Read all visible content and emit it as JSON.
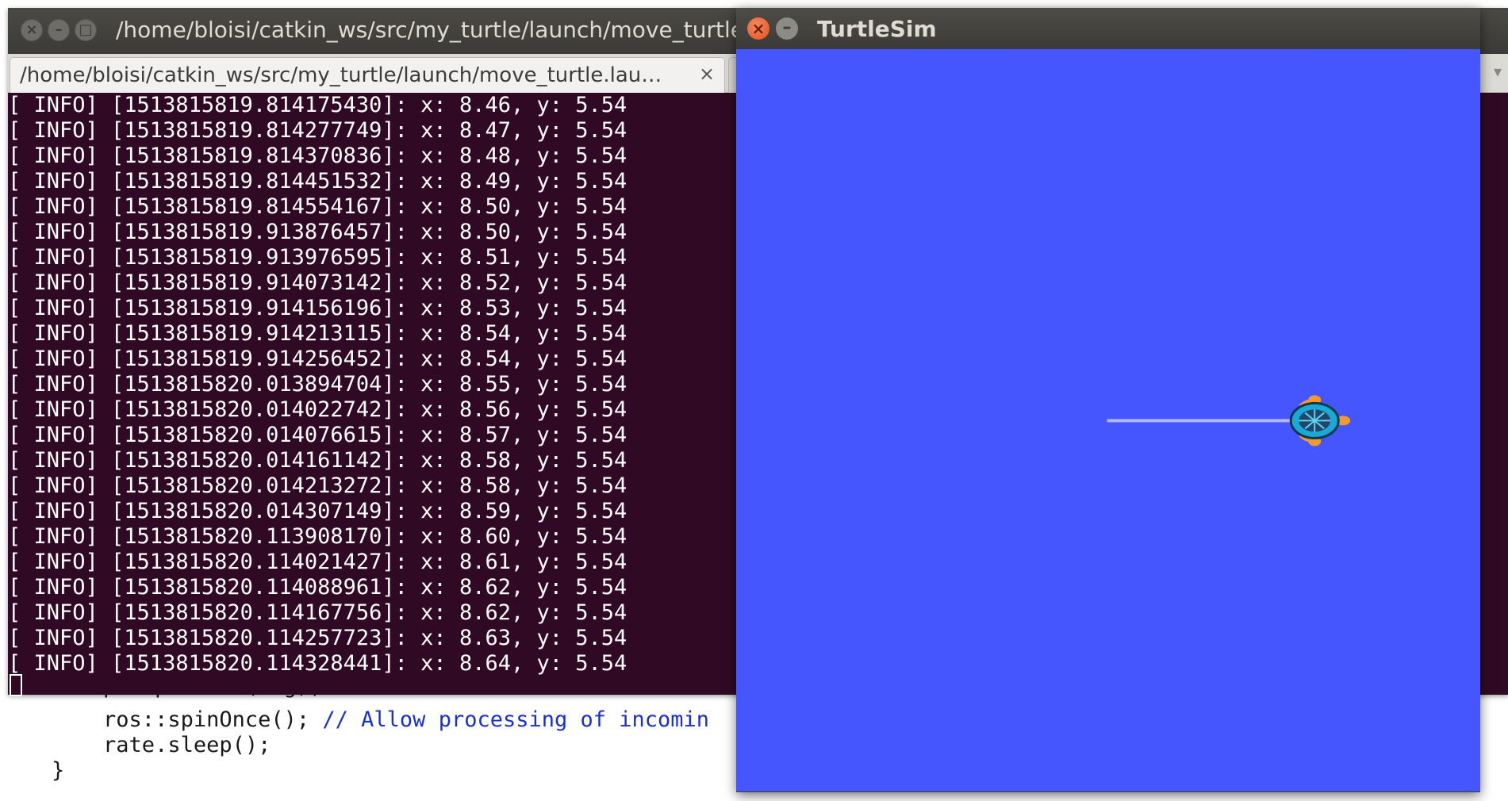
{
  "editor": {
    "lines": [
      {
        "code": "        pub.publish(msg);",
        "comment": ""
      },
      {
        "code": "        ros::spinOnce(); ",
        "comment": "// Allow processing of incomin"
      },
      {
        "code": "        rate.sleep();",
        "comment": ""
      },
      {
        "code": "    }",
        "comment": ""
      }
    ]
  },
  "terminal": {
    "title": "/home/bloisi/catkin_ws/src/my_turtle/launch/move_turtle.launch",
    "tab_label": "/home/bloisi/catkin_ws/src/my_turtle/launch/move_turtle.lau…",
    "tab_close": "×",
    "buttons": {
      "close": "×",
      "minimize": "–",
      "maximize": "□"
    },
    "log": [
      "[ INFO] [1513815819.814175430]: x: 8.46, y: 5.54",
      "[ INFO] [1513815819.814277749]: x: 8.47, y: 5.54",
      "[ INFO] [1513815819.814370836]: x: 8.48, y: 5.54",
      "[ INFO] [1513815819.814451532]: x: 8.49, y: 5.54",
      "[ INFO] [1513815819.814554167]: x: 8.50, y: 5.54",
      "[ INFO] [1513815819.913876457]: x: 8.50, y: 5.54",
      "[ INFO] [1513815819.913976595]: x: 8.51, y: 5.54",
      "[ INFO] [1513815819.914073142]: x: 8.52, y: 5.54",
      "[ INFO] [1513815819.914156196]: x: 8.53, y: 5.54",
      "[ INFO] [1513815819.914213115]: x: 8.54, y: 5.54",
      "[ INFO] [1513815819.914256452]: x: 8.54, y: 5.54",
      "[ INFO] [1513815820.013894704]: x: 8.55, y: 5.54",
      "[ INFO] [1513815820.014022742]: x: 8.56, y: 5.54",
      "[ INFO] [1513815820.014076615]: x: 8.57, y: 5.54",
      "[ INFO] [1513815820.014161142]: x: 8.58, y: 5.54",
      "[ INFO] [1513815820.014213272]: x: 8.58, y: 5.54",
      "[ INFO] [1513815820.014307149]: x: 8.59, y: 5.54",
      "[ INFO] [1513815820.113908170]: x: 8.60, y: 5.54",
      "[ INFO] [1513815820.114021427]: x: 8.61, y: 5.54",
      "[ INFO] [1513815820.114088961]: x: 8.62, y: 5.54",
      "[ INFO] [1513815820.114167756]: x: 8.62, y: 5.54",
      "[ INFO] [1513815820.114257723]: x: 8.63, y: 5.54",
      "[ INFO] [1513815820.114328441]: x: 8.64, y: 5.54"
    ]
  },
  "turtlesim": {
    "title": "TurtleSim",
    "buttons": {
      "close": "×",
      "minimize": "–"
    },
    "background_color": "#4556ff",
    "trail_color": "#b3b8ff",
    "turtle": {
      "x_start": 5.54,
      "x_end": 8.64,
      "y": 5.54,
      "world_size": 11.09
    }
  }
}
